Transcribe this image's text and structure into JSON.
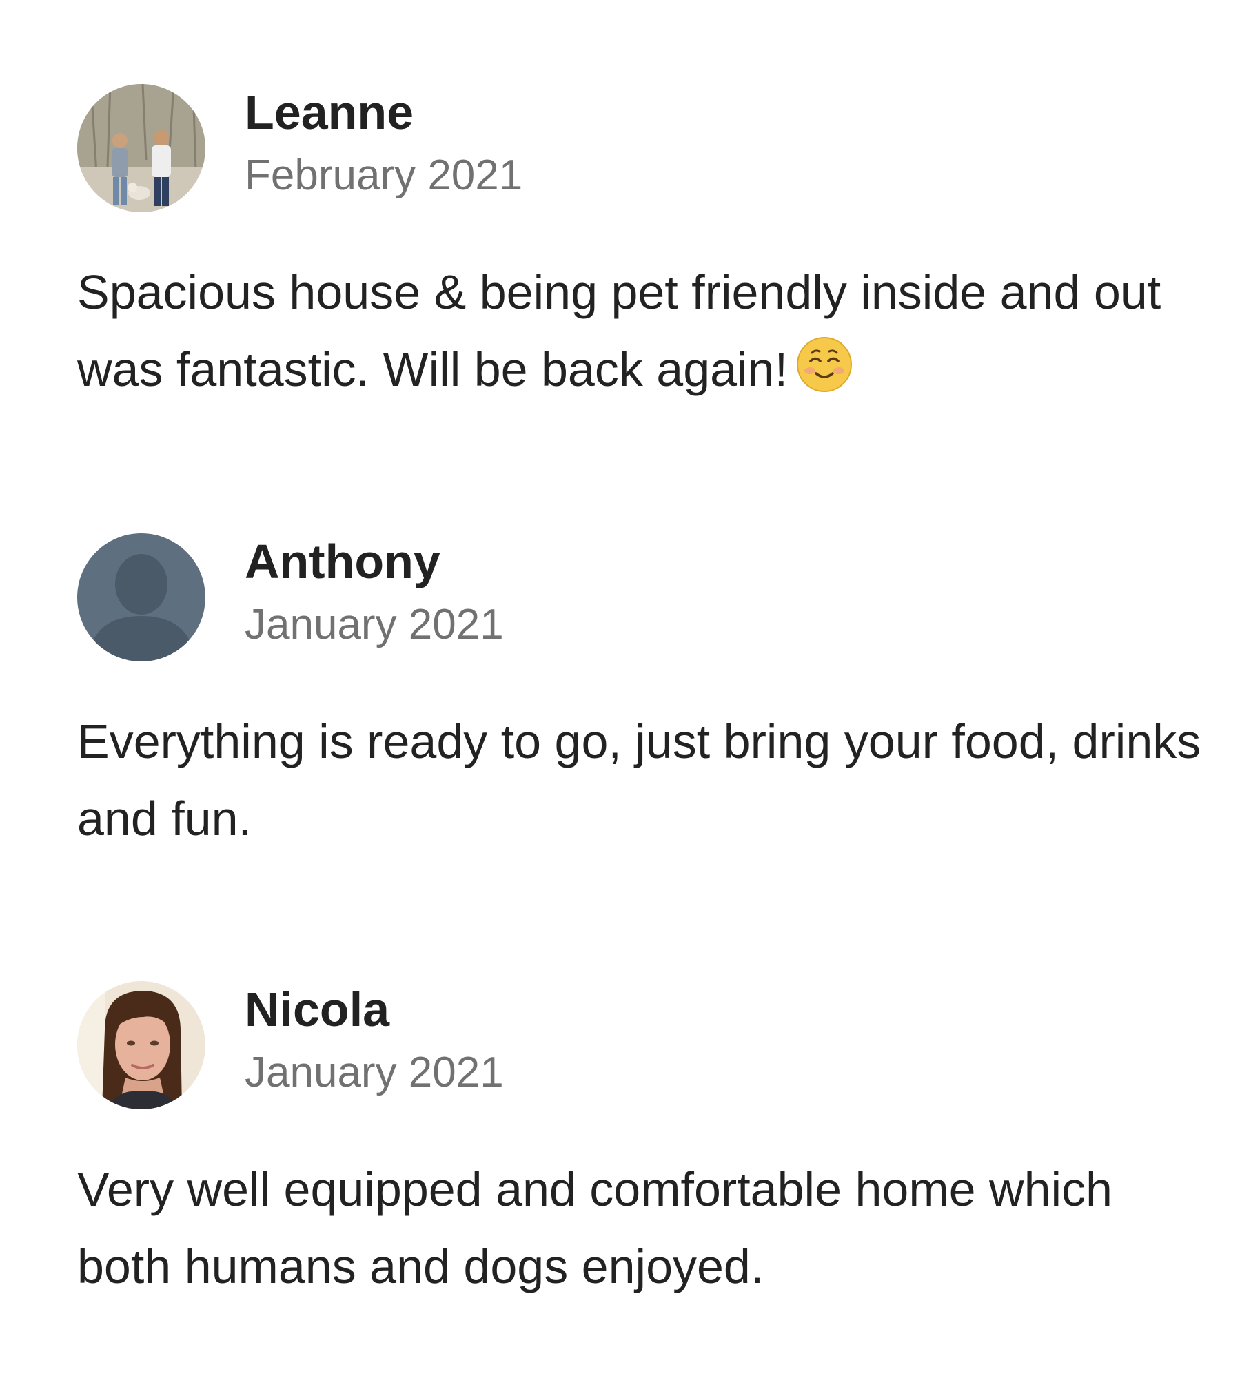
{
  "reviews": [
    {
      "name": "Leanne",
      "date": "February 2021",
      "text": "Spacious house & being pet friendly inside and out was fantastic. Will be back again!",
      "emoji": "smiling-face-icon",
      "avatar": "photo-two-people-with-dog"
    },
    {
      "name": "Anthony",
      "date": "January 2021",
      "text": "Everything is ready to go, just bring your food, drinks and fun.",
      "avatar": "default-user-silhouette"
    },
    {
      "name": "Nicola",
      "date": "January 2021",
      "text": "Very well equipped and comfortable home which both humans and dogs enjoyed.",
      "avatar": "photo-woman-portrait"
    }
  ],
  "colors": {
    "name": "#222222",
    "date": "#717171",
    "text": "#222222",
    "default_avatar": "#5e6f80"
  }
}
